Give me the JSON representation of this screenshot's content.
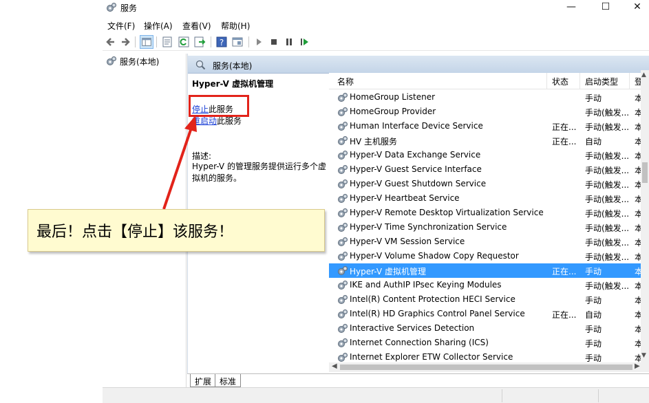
{
  "window": {
    "title": "服务",
    "minimize_label": "—",
    "maximize_label": "☐",
    "close_label": "✕"
  },
  "menu": [
    "文件(F)",
    "操作(A)",
    "查看(V)",
    "帮助(H)"
  ],
  "toolbar": {
    "icons": [
      "back-icon",
      "forward-icon",
      "show-tree-icon",
      "properties-icon",
      "refresh-icon",
      "export-icon",
      "help-icon",
      "console-icon",
      "start-icon",
      "stop-icon",
      "pause-icon",
      "restart-icon"
    ]
  },
  "tree": {
    "item": "服务(本地)"
  },
  "header": {
    "title": "服务(本地)"
  },
  "detail": {
    "service_title": "Hyper-V 虚拟机管理",
    "stop_link": "停止",
    "stop_rest": "此服务",
    "restart_link": "重启动",
    "restart_rest": "此服务",
    "desc_label": "描述:",
    "desc_text": "Hyper-V 的管理服务提供运行多个虚拟机的服务。"
  },
  "columns": {
    "name": "名称",
    "status": "状态",
    "startup": "启动类型",
    "extra": "登"
  },
  "rows": [
    {
      "name": "HomeGroup Listener",
      "status": "",
      "startup": "手动",
      "extra": "本"
    },
    {
      "name": "HomeGroup Provider",
      "status": "",
      "startup": "手动(触发...",
      "extra": "本"
    },
    {
      "name": "Human Interface Device Service",
      "status": "正在...",
      "startup": "手动(触发...",
      "extra": "本"
    },
    {
      "name": "HV 主机服务",
      "status": "正在...",
      "startup": "自动",
      "extra": "本"
    },
    {
      "name": "Hyper-V Data Exchange Service",
      "status": "",
      "startup": "手动(触发...",
      "extra": "本"
    },
    {
      "name": "Hyper-V Guest Service Interface",
      "status": "",
      "startup": "手动(触发...",
      "extra": "本"
    },
    {
      "name": "Hyper-V Guest Shutdown Service",
      "status": "",
      "startup": "手动(触发...",
      "extra": "本"
    },
    {
      "name": "Hyper-V Heartbeat Service",
      "status": "",
      "startup": "手动(触发...",
      "extra": "本"
    },
    {
      "name": "Hyper-V Remote Desktop Virtualization Service",
      "status": "",
      "startup": "手动(触发...",
      "extra": "本"
    },
    {
      "name": "Hyper-V Time Synchronization Service",
      "status": "",
      "startup": "手动(触发...",
      "extra": "本"
    },
    {
      "name": "Hyper-V VM Session Service",
      "status": "",
      "startup": "手动(触发...",
      "extra": "本"
    },
    {
      "name": "Hyper-V Volume Shadow Copy Requestor",
      "status": "",
      "startup": "手动(触发...",
      "extra": "本"
    },
    {
      "name": "Hyper-V 虚拟机管理",
      "status": "正在...",
      "startup": "手动",
      "extra": "本",
      "selected": true
    },
    {
      "name": "IKE and AuthIP IPsec Keying Modules",
      "status": "",
      "startup": "手动(触发...",
      "extra": "本"
    },
    {
      "name": "Intel(R) Content Protection HECI Service",
      "status": "",
      "startup": "手动",
      "extra": "本"
    },
    {
      "name": "Intel(R) HD Graphics Control Panel Service",
      "status": "正在...",
      "startup": "自动",
      "extra": "本"
    },
    {
      "name": "Interactive Services Detection",
      "status": "",
      "startup": "手动",
      "extra": "本"
    },
    {
      "name": "Internet Connection Sharing (ICS)",
      "status": "",
      "startup": "手动",
      "extra": "本"
    },
    {
      "name": "Internet Explorer ETW Collector Service",
      "status": "",
      "startup": "手动",
      "extra": "本"
    }
  ],
  "tabs": {
    "extended": "扩展",
    "standard": "标准"
  },
  "annotation": {
    "callout_text": "最后！点击【停止】该服务！"
  },
  "colors": {
    "selection": "#3399ff",
    "link": "#1a3fd6",
    "highlight": "#e2231a",
    "callout_bg": "#fffbd0"
  }
}
